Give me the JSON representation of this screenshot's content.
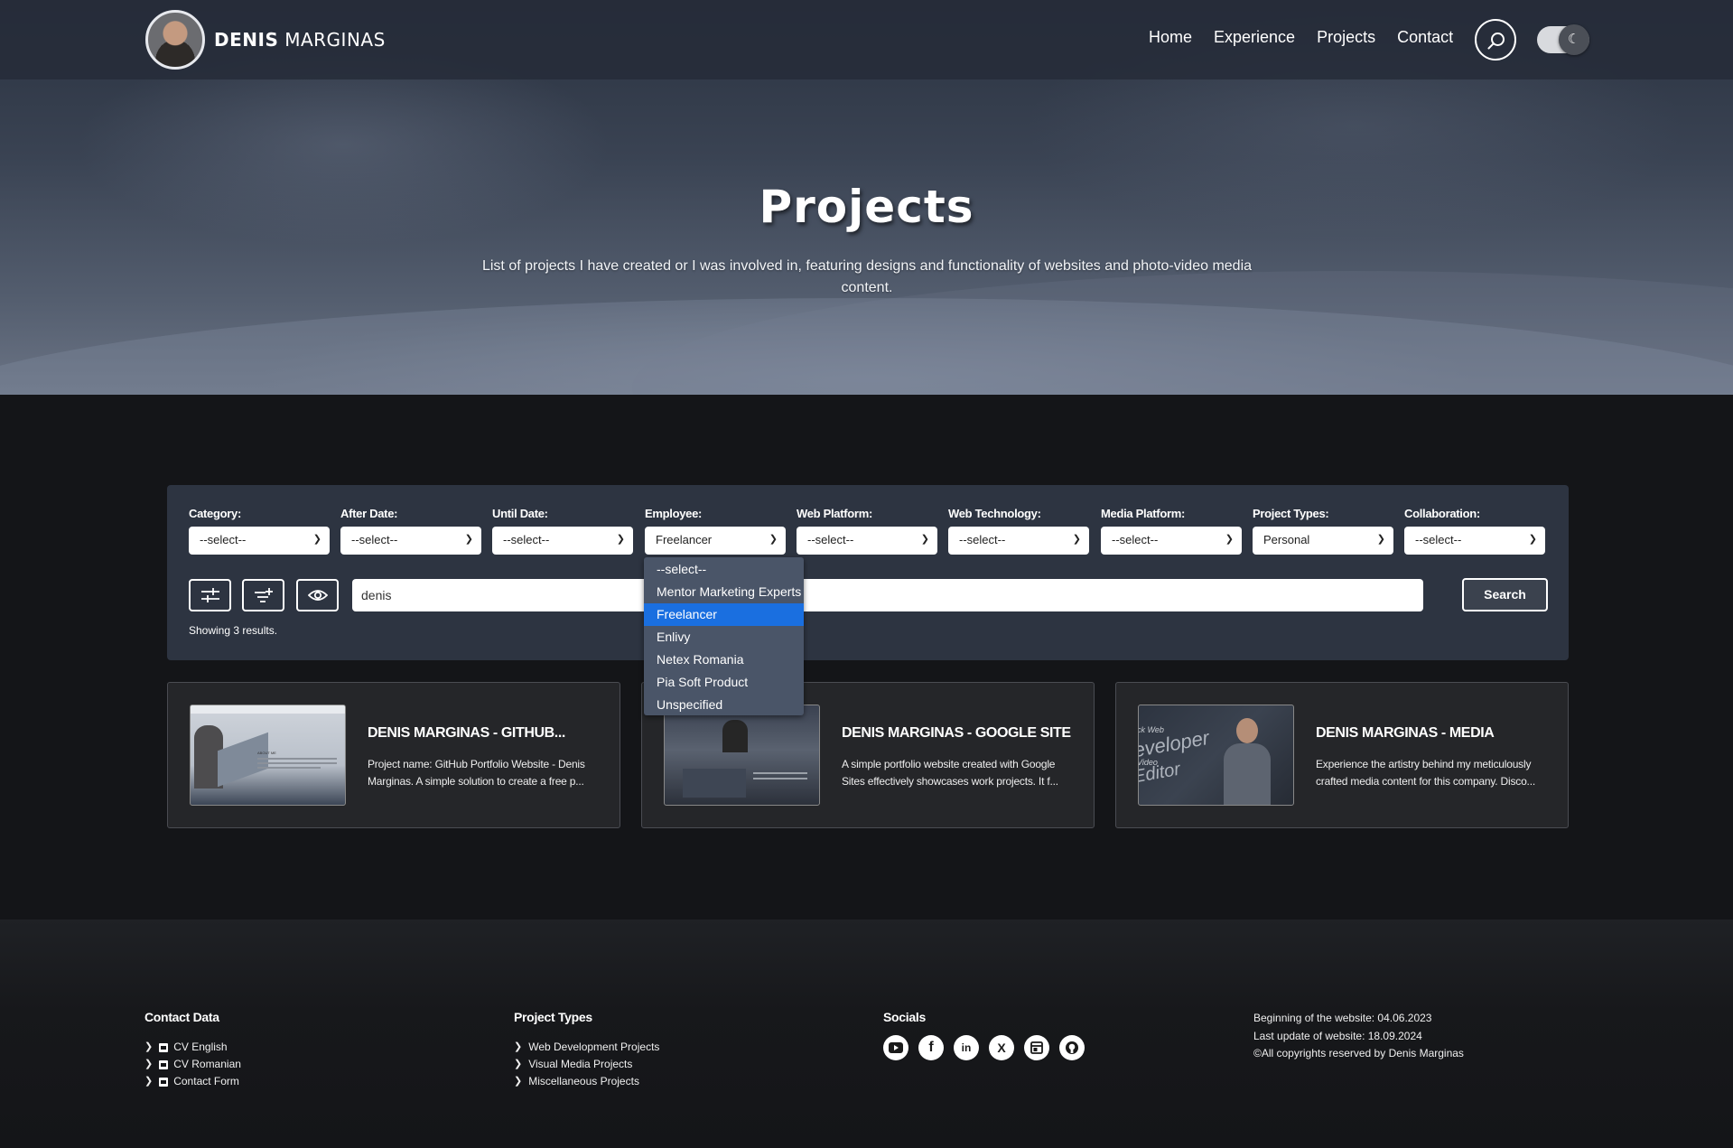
{
  "brand": {
    "name_bold": "DENIS",
    "name_light": "MARGINAS"
  },
  "nav": [
    "Home",
    "Experience",
    "Projects",
    "Contact"
  ],
  "hero": {
    "title": "Projects",
    "subtitle": "List of projects I have created or I was involved in, featuring designs and functionality of websites and photo-video media content."
  },
  "filters": [
    {
      "label": "Category:",
      "value": "--select--"
    },
    {
      "label": "After Date:",
      "value": "--select--"
    },
    {
      "label": "Until Date:",
      "value": "--select--"
    },
    {
      "label": "Employee:",
      "value": "Freelancer"
    },
    {
      "label": "Web Platform:",
      "value": "--select--"
    },
    {
      "label": "Web Technology:",
      "value": "--select--"
    },
    {
      "label": "Media Platform:",
      "value": "--select--"
    },
    {
      "label": "Project Types:",
      "value": "Personal"
    },
    {
      "label": "Collaboration:",
      "value": "--select--"
    }
  ],
  "employee_dropdown": {
    "options": [
      "--select--",
      "Mentor Marketing Experts",
      "Freelancer",
      "Enlivy",
      "Netex Romania",
      "Pia Soft Product",
      "Unspecified"
    ],
    "selected": "Freelancer"
  },
  "search": {
    "value": "denis",
    "button": "Search"
  },
  "results_text": "Showing 3 results.",
  "projects": [
    {
      "title": "DENIS MARGINAS - GITHUB...",
      "desc": "Project name: GitHub Portfolio Website - Denis Marginas. A simple solution to create a free p..."
    },
    {
      "title": "DENIS MARGINAS - GOOGLE SITE",
      "desc": "A simple portfolio website created with Google Sites effectively showcases work projects. It f..."
    },
    {
      "title": "DENIS MARGINAS - MEDIA",
      "desc": "Experience the artistry behind my meticulously crafted media content for this company. Disco..."
    }
  ],
  "thumb_text": {
    "about": "ABOUT ME",
    "media_line1": "ck Web",
    "media_line2": "eveloper",
    "media_line3": "Video",
    "media_line4": "Editor"
  },
  "footer": {
    "contact": {
      "title": "Contact Data",
      "links": [
        "CV English",
        "CV Romanian",
        "Contact Form"
      ]
    },
    "types": {
      "title": "Project Types",
      "links": [
        "Web Development Projects",
        "Visual Media Projects",
        "Miscellaneous Projects"
      ]
    },
    "socials": {
      "title": "Socials",
      "icons": [
        "youtube-icon",
        "facebook-icon",
        "linkedin-icon",
        "x-icon",
        "website-icon",
        "github-icon"
      ]
    },
    "info": [
      "Beginning of the website: 04.06.2023",
      "Last update of website: 18.09.2024",
      "©All copyrights reserved by Denis Marginas"
    ]
  },
  "colors": {
    "panel": "#2d3441",
    "dropdown_active": "#1a6fe0",
    "card_bg": "#252629",
    "page_bg": "#141518"
  }
}
